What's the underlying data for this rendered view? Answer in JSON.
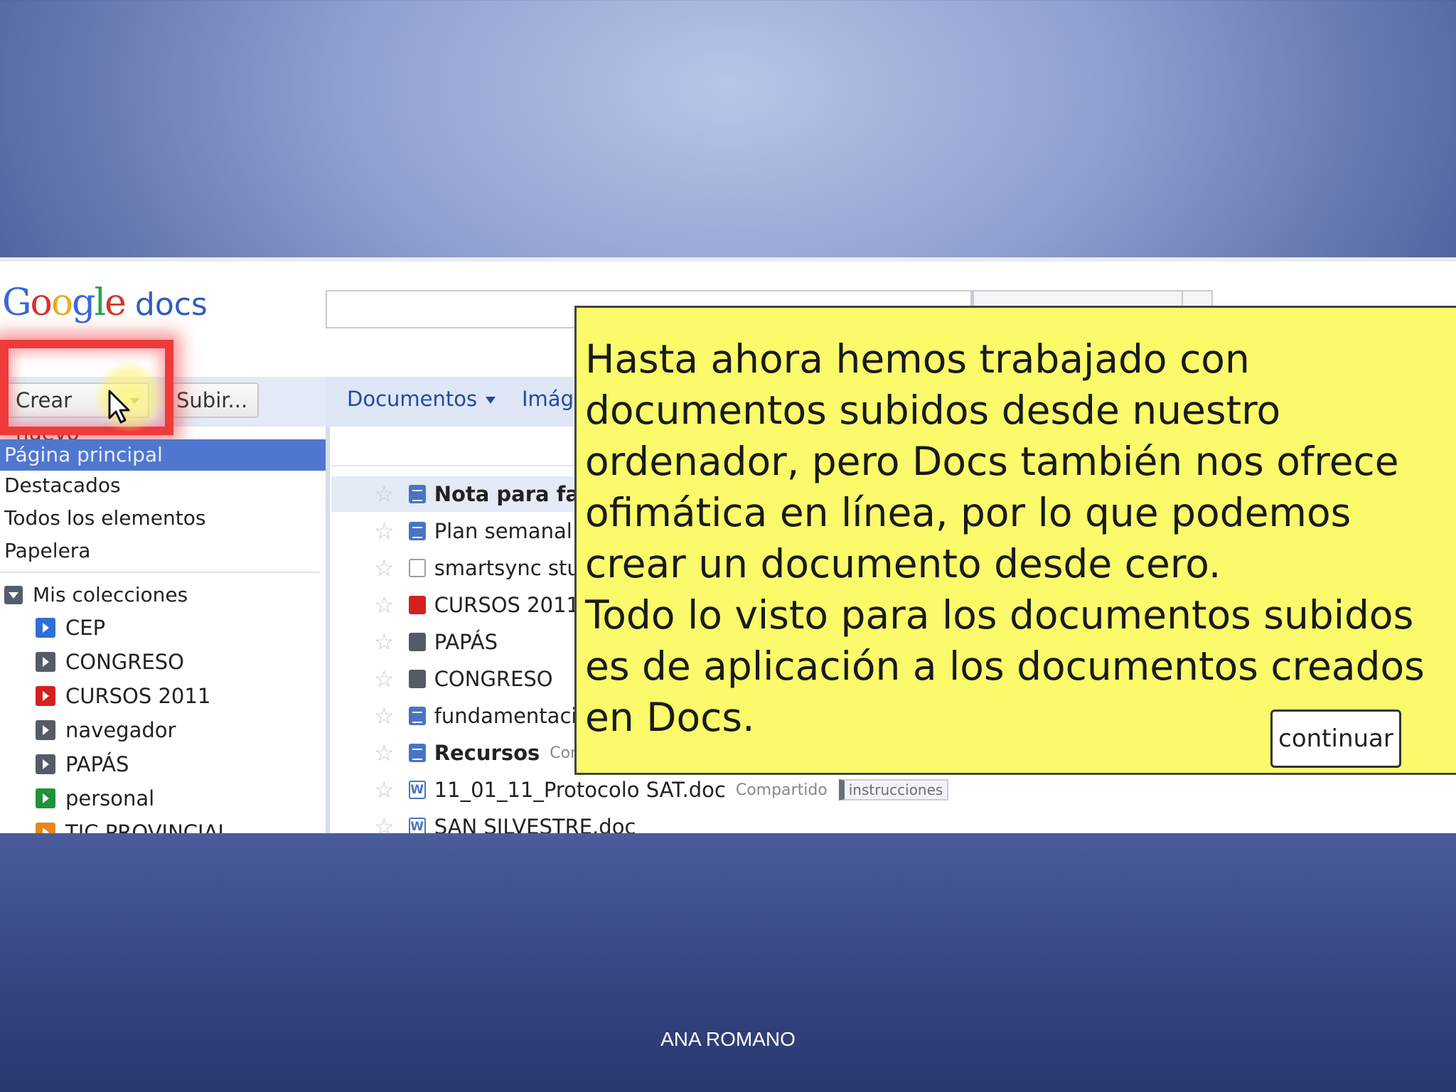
{
  "app": {
    "logo_google": [
      "G",
      "o",
      "o",
      "g",
      "l",
      "e"
    ],
    "logo_docs": "docs"
  },
  "toolbar": {
    "create_label": "Crear nuevo",
    "upload_label": "Subir..."
  },
  "tabs": [
    {
      "label": "Documentos"
    },
    {
      "label": "Imáge"
    }
  ],
  "sidebar": {
    "active_item": "Página principal",
    "items": [
      "Destacados",
      "Todos los elementos",
      "Papelera"
    ],
    "collections_header": "Mis colecciones",
    "collections": [
      {
        "label": "CEP",
        "color": "#2f6fd6"
      },
      {
        "label": "CONGRESO",
        "color": "#555b66"
      },
      {
        "label": "CURSOS 2011",
        "color": "#d62020"
      },
      {
        "label": "navegador",
        "color": "#555b66"
      },
      {
        "label": "PAPÁS",
        "color": "#555b66"
      },
      {
        "label": "personal",
        "color": "#21913a"
      },
      {
        "label": "TIC PROVINCIAL",
        "color": "#e8861a"
      }
    ]
  },
  "documents": [
    {
      "name": "Nota para fam",
      "icon": "doc-icon",
      "color": "#4a73c4",
      "bold": true
    },
    {
      "name": "Plan semanal",
      "icon": "doc-icon",
      "color": "#4a73c4"
    },
    {
      "name": "smartsync stud",
      "icon": "file-icon",
      "color": "#ffffff"
    },
    {
      "name": "CURSOS 2011",
      "icon": "folder-icon",
      "color": "#d62020"
    },
    {
      "name": "PAPÁS",
      "icon": "folder-icon",
      "color": "#555b66"
    },
    {
      "name": "CONGRESO",
      "icon": "folder-icon",
      "color": "#555b66"
    },
    {
      "name": "fundamentacion",
      "icon": "doc-icon",
      "color": "#4a73c4"
    },
    {
      "name": "Recursos",
      "icon": "doc-icon",
      "color": "#4a73c4",
      "bold": true,
      "shared": "Comp"
    },
    {
      "name": "11_01_11_Protocolo SAT.doc",
      "icon": "word-icon",
      "color": "#4a73c4",
      "shared": "Compartido",
      "tag": "instrucciones"
    },
    {
      "name": "SAN SILVESTRE.doc",
      "icon": "word-icon",
      "color": "#4a73c4"
    }
  ],
  "callout": {
    "text": "Hasta ahora hemos trabajado con documentos subidos desde nuestro ordenador, pero Docs también nos ofrece ofimática en línea, por lo que podemos crear un documento desde cero.\nTodo lo visto para los documentos subidos es de aplicación a los documentos creados en Docs.",
    "button_label": "continuar"
  },
  "footer": {
    "author": "ANA ROMANO"
  }
}
